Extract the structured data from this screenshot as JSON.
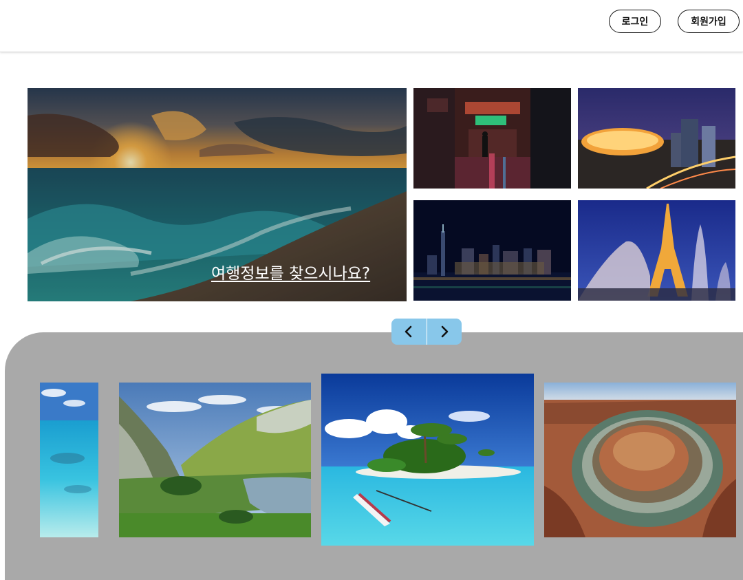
{
  "header": {
    "login_label": "로그인",
    "signup_label": "회원가입"
  },
  "hero": {
    "caption": "여행정보를 찾으시나요?"
  },
  "colors": {
    "nav_accent": "#88c7ea",
    "gallery_bg": "#a9a9a9"
  },
  "carousel": {
    "prev_icon": "chevron-left-icon",
    "next_icon": "chevron-right-icon"
  }
}
